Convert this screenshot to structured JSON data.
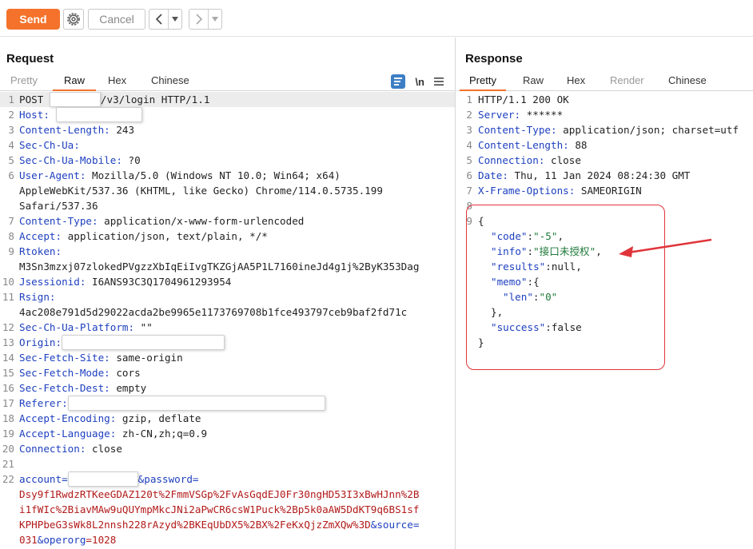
{
  "toolbar": {
    "send_label": "Send",
    "cancel_label": "Cancel",
    "gear_icon": "gear-icon",
    "back_icon": "chevron-left-icon",
    "forward_icon": "chevron-right-icon",
    "accent_color": "#f4722b"
  },
  "request": {
    "title": "Request",
    "tabs": [
      "Pretty",
      "Raw",
      "Hex",
      "Chinese"
    ],
    "active_tab": "Raw",
    "newline_toggle": "\\n",
    "lines": {
      "l1_method": "POST ",
      "l1_path": "/v3/login HTTP/1.1",
      "host_key": "Host:",
      "cl_key": "Content-Length:",
      "cl_val": " 243",
      "chua_key": "Sec-Ch-Ua:",
      "mob_key": "Sec-Ch-Ua-Mobile:",
      "mob_val": " ?0",
      "ua_key": "User-Agent:",
      "ua_val": " Mozilla/5.0 (Windows NT 10.0; Win64; x64)",
      "ua_cont1": "AppleWebKit/537.36 (KHTML, like Gecko) Chrome/114.0.5735.199",
      "ua_cont2": "Safari/537.36",
      "ct_key": "Content-Type:",
      "ct_val": " application/x-www-form-urlencoded",
      "acc_key": "Accept:",
      "acc_val": " application/json, text/plain, */*",
      "rt_key": "Rtoken:",
      "rt_val": "M3Sn3mzxj07zlokedPVgzzXbIqEiIvgTKZGjAA5P1L7160ineJd4g1j%2ByK353Dag",
      "js_key": "Jsessionid:",
      "js_val": " I6ANS93C3Q1704961293954",
      "rs_key": "Rsign:",
      "rs_val": "4ac208e791d5d29022acda2be9965e1173769708b1fce493797ceb9baf2fd71c",
      "plat_key": "Sec-Ch-Ua-Platform:",
      "plat_val": " \"\"",
      "orig_key": "Origin:",
      "sfs_key": "Sec-Fetch-Site:",
      "sfs_val": " same-origin",
      "sfm_key": "Sec-Fetch-Mode:",
      "sfm_val": " cors",
      "sfd_key": "Sec-Fetch-Dest:",
      "sfd_val": " empty",
      "ref_key": "Referer:",
      "ae_key": "Accept-Encoding:",
      "ae_val": " gzip, deflate",
      "al_key": "Accept-Language:",
      "al_val": " zh-CN,zh;q=0.9",
      "conn_key": "Connection:",
      "conn_val": " close",
      "b_account": "account=",
      "b_amp_pw": "&password=",
      "b_pw1": "Dsy9f1RwdzRTKeeGDAZ120t%2FmmVSGp%2FvAsGqdEJ0Fr30ngHD53I3xBwHJnn%2B",
      "b_pw2": "i1fWIc%2BiavMAw9uQUYmpMkcJNi2aPwCR6csW1Puck%2Bp5k0aAW5DdKT9q6BS1sf",
      "b_pw3": "KPHPbeG3sWk8L2nnsh228rAzyd%2BKEqUbDX5%2BX%2FeKxQjzZmXQw%3D",
      "b_amp_src": "&source",
      "b_eq": "=",
      "b_src_val": "031",
      "b_amp_op": "&operorg",
      "b_op_val": "=1028"
    }
  },
  "response": {
    "title": "Response",
    "tabs": [
      "Pretty",
      "Raw",
      "Hex",
      "Render",
      "Chinese"
    ],
    "active_tab": "Pretty",
    "lines": {
      "status": "HTTP/1.1 200 OK",
      "srv_key": "Server:",
      "srv_val": " ******",
      "ct_key": "Content-Type:",
      "ct_val": " application/json; charset=utf",
      "cl_key": "Content-Length:",
      "cl_val": " 88",
      "conn_key": "Connection:",
      "conn_val": " close",
      "date_key": "Date:",
      "date_val": " Thu, 11 Jan 2024 08:24:30 GMT",
      "xfo_key": "X-Frame-Options:",
      "xfo_val": " SAMEORIGIN",
      "j_open": "{",
      "j_code_k": "\"code\"",
      "j_code_v": "\"-5\"",
      "j_info_k": "\"info\"",
      "j_info_v": "\"接口未授权\"",
      "j_results_k": "\"results\"",
      "j_results_v": "null",
      "j_memo_k": "\"memo\"",
      "j_memo_open": "{",
      "j_len_k": "\"len\"",
      "j_len_v": "\"0\"",
      "j_memo_close": "},",
      "j_success_k": "\"success\"",
      "j_success_v": "false",
      "j_close": "}"
    }
  }
}
